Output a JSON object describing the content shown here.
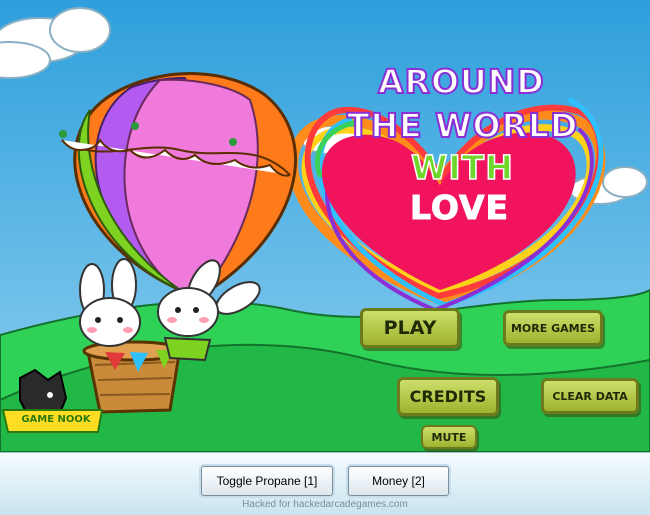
{
  "title": {
    "line1": "AROUND",
    "line2": "THE WORLD",
    "line3": "WITH",
    "line4": "LOVE"
  },
  "menu": {
    "play": "PLAY",
    "more_games": "MORE GAMES",
    "credits": "CREDITS",
    "clear_data": "CLEAR DATA",
    "mute": "MUTE"
  },
  "logo": {
    "text": "GAME NOOK"
  },
  "hack_bar": {
    "toggle_propane": "Toggle Propane [1]",
    "money": "Money [2]",
    "credit": "Hacked for hackedarcadegames.com"
  },
  "colors": {
    "sky": "#4aaee0",
    "hill": "#23c046",
    "heart": "#f2135d",
    "button": "#b5c84a",
    "title_purple": "#8a2ed6",
    "title_green": "#6fd62a"
  }
}
